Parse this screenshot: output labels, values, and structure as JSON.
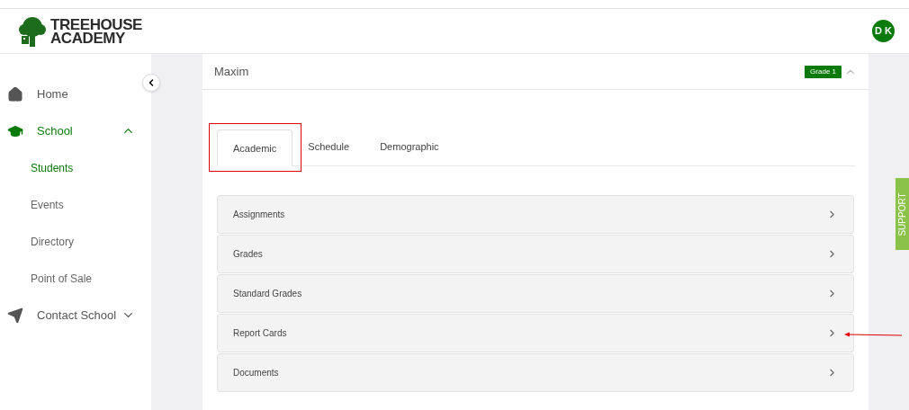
{
  "header": {
    "logo_text": [
      "TREEHOUSE",
      "ACADEMY"
    ],
    "avatar": "D K"
  },
  "sidebar": {
    "items": [
      {
        "label": "Home",
        "kind": "home",
        "selected": false
      },
      {
        "label": "School",
        "kind": "school",
        "selected": false,
        "expanded": true,
        "children": [
          {
            "label": "Students",
            "selected": true
          },
          {
            "label": "Events",
            "selected": false
          },
          {
            "label": "Directory",
            "selected": false
          },
          {
            "label": "Point of Sale",
            "selected": false
          }
        ]
      },
      {
        "label": "Contact School",
        "kind": "send",
        "selected": false,
        "expanded": false
      }
    ]
  },
  "student": {
    "name": "Maxim",
    "badge": "Grade 1",
    "expanded": true,
    "tabs": [
      {
        "label": "Academic",
        "selected": true
      },
      {
        "label": "Schedule",
        "selected": false
      },
      {
        "label": "Demographic",
        "selected": false
      }
    ],
    "sections": [
      "Assignments",
      "Grades",
      "Standard Grades",
      "Report Cards",
      "Documents"
    ]
  },
  "support_tab": "SUPPORT"
}
